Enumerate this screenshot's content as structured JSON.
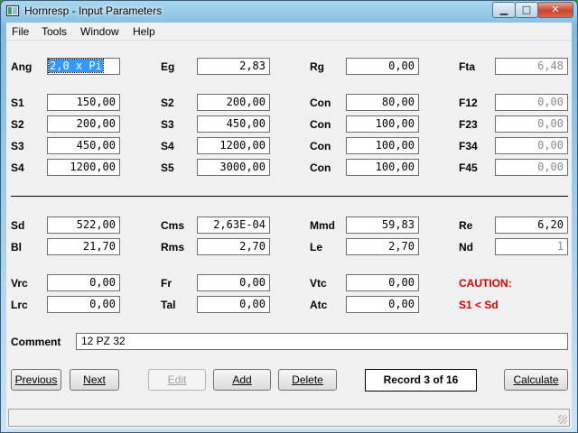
{
  "window": {
    "title": "Hornresp - Input Parameters",
    "min_glyph": "▁",
    "max_glyph": "□",
    "close_glyph": "✕"
  },
  "menu": [
    "File",
    "Tools",
    "Window",
    "Help"
  ],
  "labels": {
    "ang": "Ang",
    "eg": "Eg",
    "rg": "Rg",
    "fta": "Fta",
    "s1": "S1",
    "s2": "S2",
    "s3": "S3",
    "s4": "S4",
    "s5": "S5",
    "con": "Con",
    "f12": "F12",
    "f23": "F23",
    "f34": "F34",
    "f45": "F45",
    "sd": "Sd",
    "cms": "Cms",
    "mmd": "Mmd",
    "re": "Re",
    "bl": "Bl",
    "rms": "Rms",
    "le": "Le",
    "nd": "Nd",
    "vrc": "Vrc",
    "fr": "Fr",
    "vtc": "Vtc",
    "lrc": "Lrc",
    "tal": "Tal",
    "atc": "Atc",
    "comment": "Comment"
  },
  "values": {
    "ang": "2,0 x Pi",
    "eg": "2,83",
    "rg": "0,00",
    "fta": "6,48",
    "left_s1": "150,00",
    "left_s2": "200,00",
    "left_s3": "450,00",
    "left_s4": "1200,00",
    "mid_s2": "200,00",
    "mid_s3": "450,00",
    "mid_s4": "1200,00",
    "mid_s5": "3000,00",
    "con1": "80,00",
    "con2": "100,00",
    "con3": "100,00",
    "con4": "100,00",
    "f12": "0,00",
    "f23": "0,00",
    "f34": "0,00",
    "f45": "0,00",
    "sd": "522,00",
    "cms": "2,63E-04",
    "mmd": "59,83",
    "re": "6,20",
    "bl": "21,70",
    "rms": "2,70",
    "le": "2,70",
    "nd": "1",
    "vrc": "0,00",
    "fr": "0,00",
    "vtc": "0,00",
    "lrc": "0,00",
    "tal": "0,00",
    "atc": "0,00"
  },
  "caution": {
    "title": "CAUTION:",
    "message": "S1 < Sd"
  },
  "comment": "12 PZ 32",
  "buttons": {
    "previous": "Previous",
    "next": "Next",
    "edit": "Edit",
    "add": "Add",
    "delete": "Delete",
    "calculate": "Calculate"
  },
  "record": "Record 3 of 16"
}
